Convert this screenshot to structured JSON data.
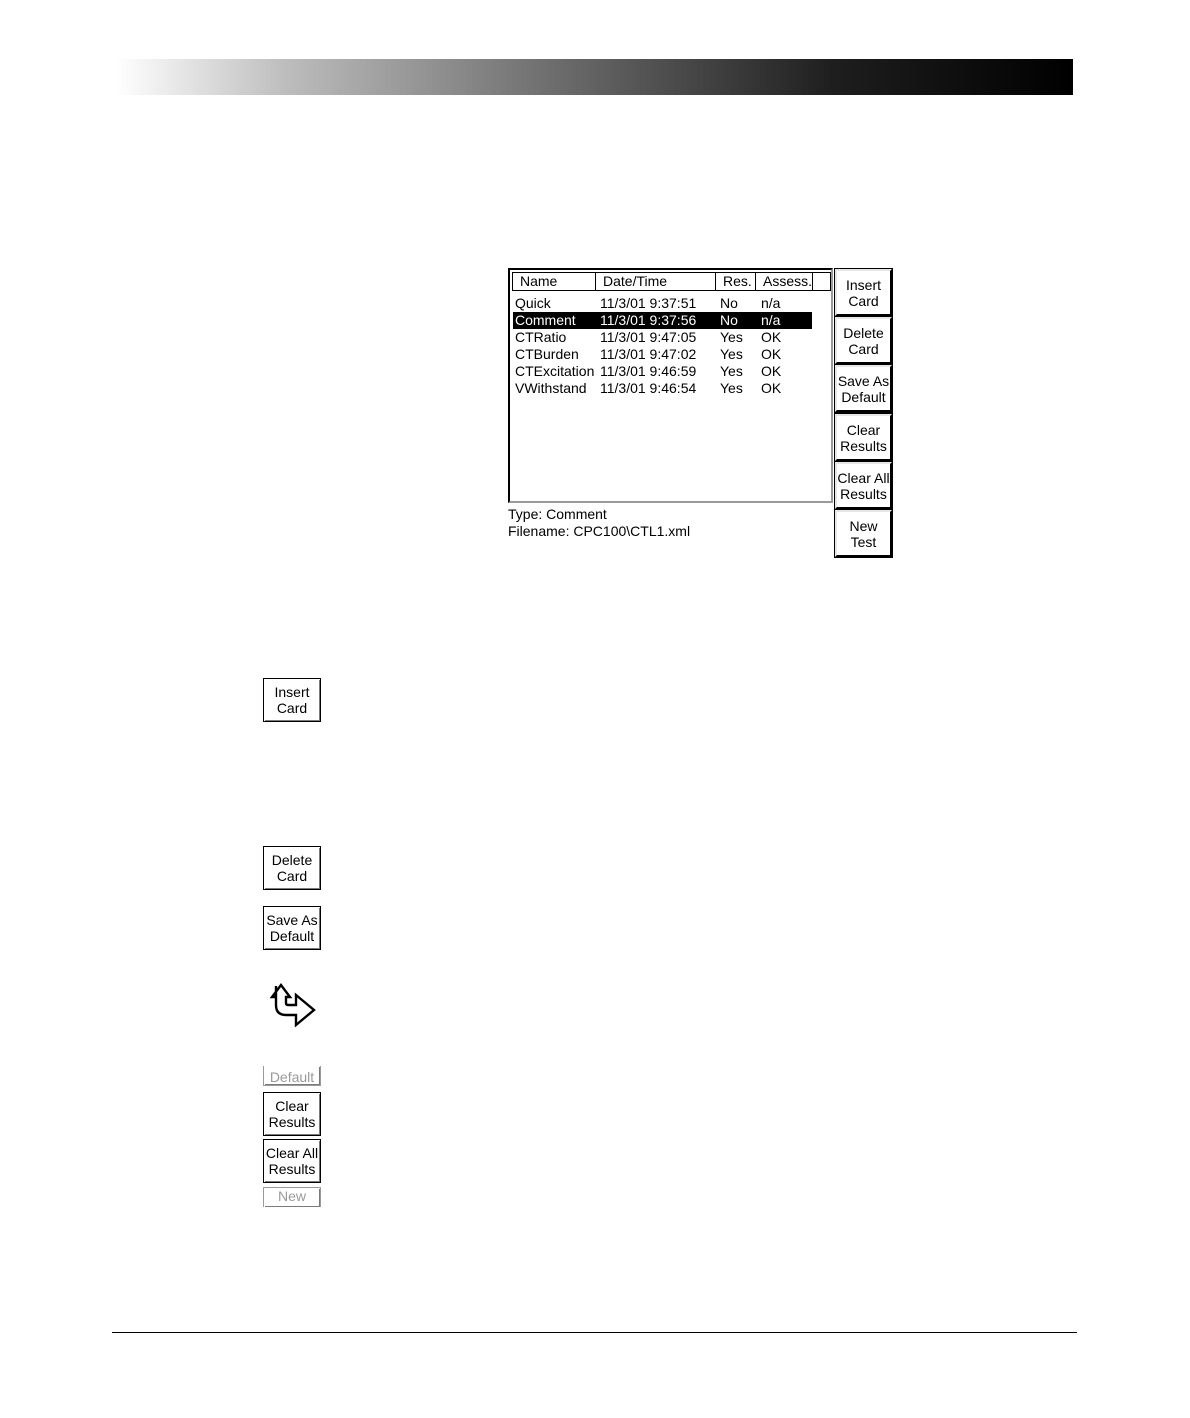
{
  "list": {
    "columns": [
      "Name",
      "Date/Time",
      "Res.",
      "Assess."
    ],
    "rows": [
      {
        "name": "Quick",
        "datetime": "11/3/01 9:37:51",
        "res": "No",
        "assess": "n/a"
      },
      {
        "name": "Comment",
        "datetime": "11/3/01 9:37:56",
        "res": "No",
        "assess": "n/a",
        "selected": true
      },
      {
        "name": "CTRatio",
        "datetime": "11/3/01 9:47:05",
        "res": "Yes",
        "assess": "OK"
      },
      {
        "name": "CTBurden",
        "datetime": "11/3/01 9:47:02",
        "res": "Yes",
        "assess": "OK"
      },
      {
        "name": "CTExcitation",
        "datetime": "11/3/01 9:46:59",
        "res": "Yes",
        "assess": "OK"
      },
      {
        "name": "VWithstand",
        "datetime": "11/3/01 9:46:54",
        "res": "Yes",
        "assess": "OK"
      }
    ]
  },
  "info": {
    "type_line": "Type: Comment",
    "filename_line": "Filename: CPC100\\CTL1.xml"
  },
  "side_buttons": {
    "insert_card": "Insert\nCard",
    "delete_card": "Delete\nCard",
    "save_as_default": "Save As\nDefault",
    "clear_results": "Clear\nResults",
    "clear_all_results": "Clear All\nResults",
    "new_test": "New\nTest"
  },
  "margin_buttons": {
    "insert_card": "Insert\nCard",
    "delete_card": "Delete\nCard",
    "save_as_default": "Save As\nDefault",
    "default_partial": "Default",
    "clear_results": "Clear\nResults",
    "clear_all_results": "Clear All\nResults",
    "new_partial": "New"
  },
  "icons": {
    "hint": "hint-arrow-icon"
  }
}
